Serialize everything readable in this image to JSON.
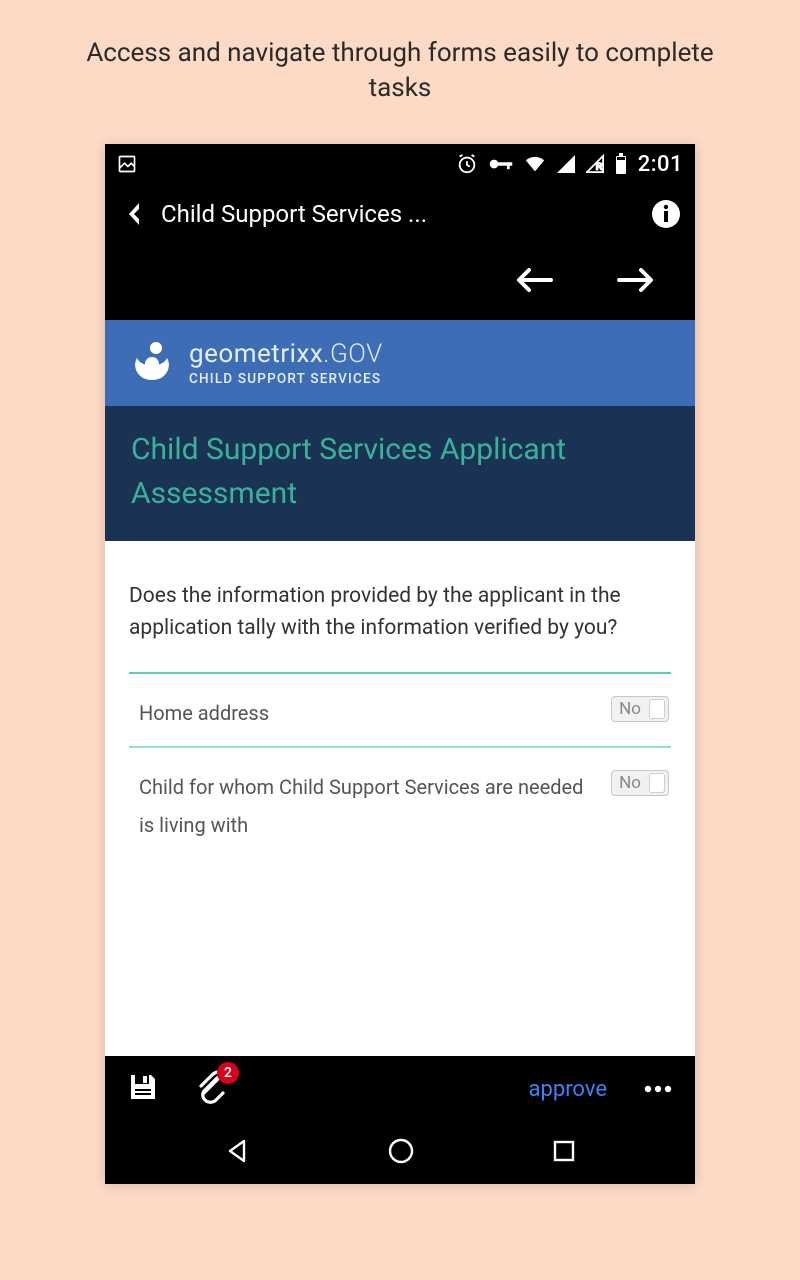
{
  "caption": "Access and navigate through forms easily to complete tasks",
  "status": {
    "time": "2:01"
  },
  "appbar": {
    "title": "Child Support Services ..."
  },
  "brand": {
    "name": "geometrixx",
    "domain": ".GOV",
    "subtitle": "CHILD SUPPORT SERVICES"
  },
  "form": {
    "heading": "Child Support Services Applicant Assessment",
    "question": "Does the information provided by the applicant in the application tally with the information verified by you?",
    "items": [
      {
        "label": "Home address",
        "value": "No"
      },
      {
        "label": "Child for whom Child Support Services are needed is living with",
        "value": "No"
      }
    ]
  },
  "bottombar": {
    "attachment_count": "2",
    "approve_label": "approve"
  }
}
